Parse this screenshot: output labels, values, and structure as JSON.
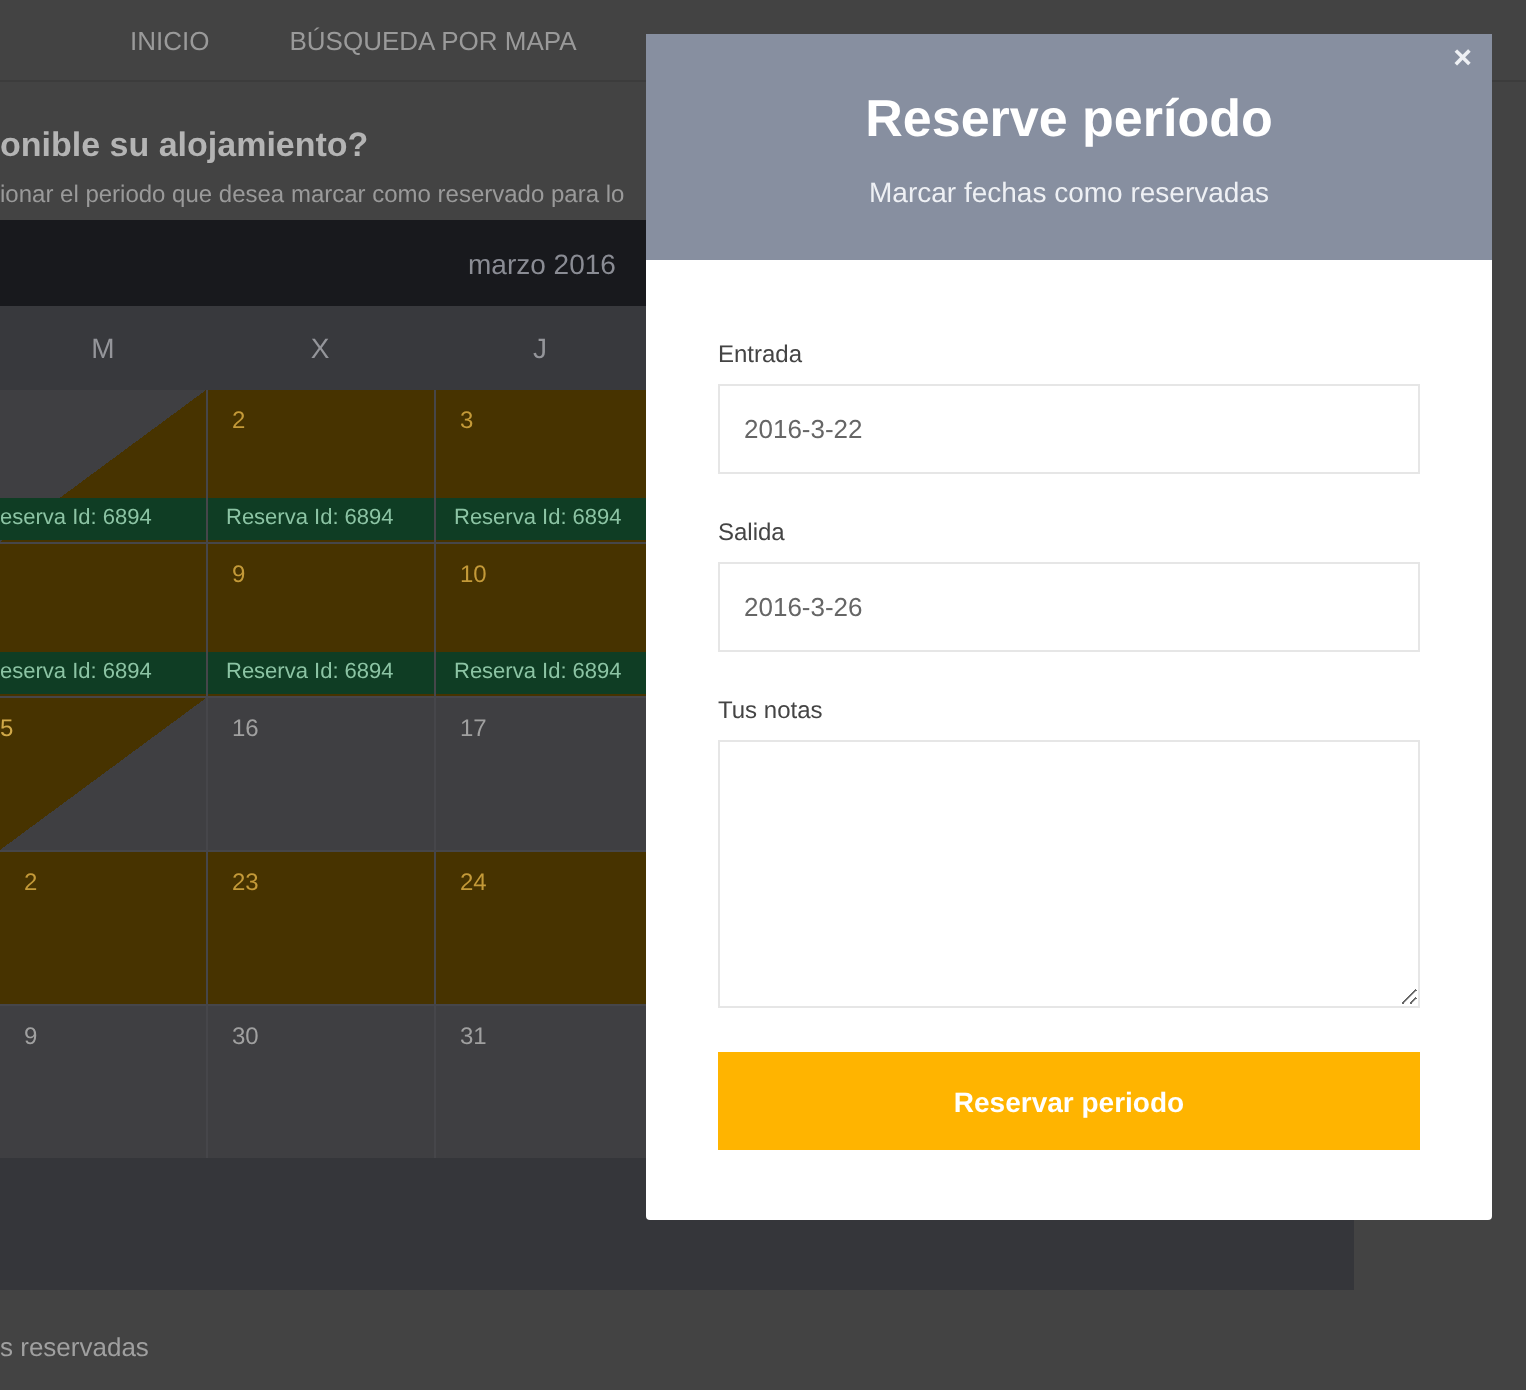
{
  "nav": {
    "items": [
      {
        "label": "INICIO"
      },
      {
        "label": "BÚSQUEDA POR MAPA"
      }
    ]
  },
  "page": {
    "heading": "onible su alojamiento?",
    "intro": "ionar el periodo que desea marcar como reservado para lo",
    "footer_note": "s reservadas"
  },
  "calendar": {
    "month": "marzo 2016",
    "weekdays": [
      "M",
      "X",
      "J"
    ],
    "weeks": [
      [
        {
          "kind": "arrival",
          "band": "eserva Id: 6894"
        },
        {
          "kind": "booked",
          "day": "2",
          "band": "Reserva Id: 6894"
        },
        {
          "kind": "booked",
          "day": "3",
          "band": "Reserva Id: 6894"
        }
      ],
      [
        {
          "kind": "booked",
          "band": "eserva Id: 6894"
        },
        {
          "kind": "booked",
          "day": "9",
          "band": "Reserva Id: 6894"
        },
        {
          "kind": "booked",
          "day": "10",
          "band": "Reserva Id: 6894"
        }
      ],
      [
        {
          "kind": "departure",
          "day": "5"
        },
        {
          "kind": "free",
          "day": "16"
        },
        {
          "kind": "free",
          "day": "17"
        }
      ],
      [
        {
          "kind": "booked",
          "day": "2"
        },
        {
          "kind": "booked",
          "day": "23"
        },
        {
          "kind": "booked",
          "day": "24"
        }
      ],
      [
        {
          "kind": "free",
          "day": "9"
        },
        {
          "kind": "free",
          "day": "30"
        },
        {
          "kind": "free",
          "day": "31"
        }
      ]
    ]
  },
  "modal": {
    "title": "Reserve período",
    "subtitle": "Marcar fechas como reservadas",
    "close": "×",
    "fields": [
      {
        "kind": "input",
        "label": "Entrada",
        "value": "2016-3-22"
      },
      {
        "kind": "input",
        "label": "Salida",
        "value": "2016-3-26"
      },
      {
        "kind": "textarea",
        "label": "Tus notas"
      }
    ],
    "submit": "Reservar periodo"
  }
}
